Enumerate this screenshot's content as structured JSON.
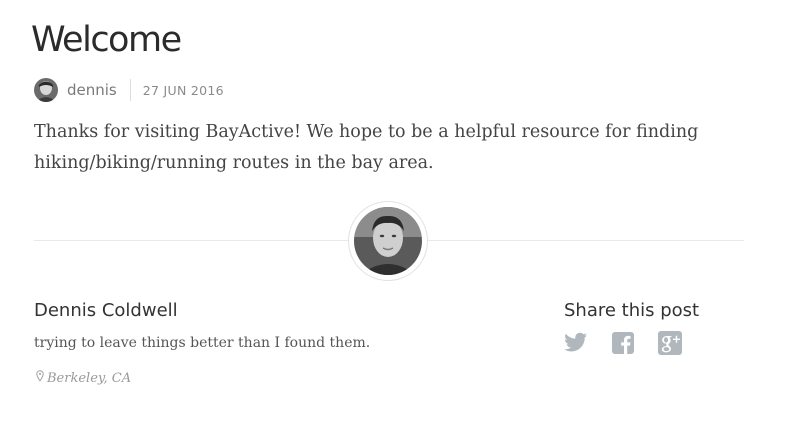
{
  "post": {
    "title": "Welcome",
    "author": "dennis",
    "date": "27 JUN 2016",
    "body": "Thanks for visiting BayActive! We hope to be a helpful resource for finding hiking/biking/running routes in the bay area."
  },
  "author_card": {
    "name": "Dennis Coldwell",
    "bio": "trying to leave things better than I found them.",
    "location": "Berkeley, CA"
  },
  "share": {
    "title": "Share this post",
    "icons": [
      "twitter-icon",
      "facebook-icon",
      "google-plus-icon"
    ],
    "icon_color": "#b0b8bd"
  }
}
